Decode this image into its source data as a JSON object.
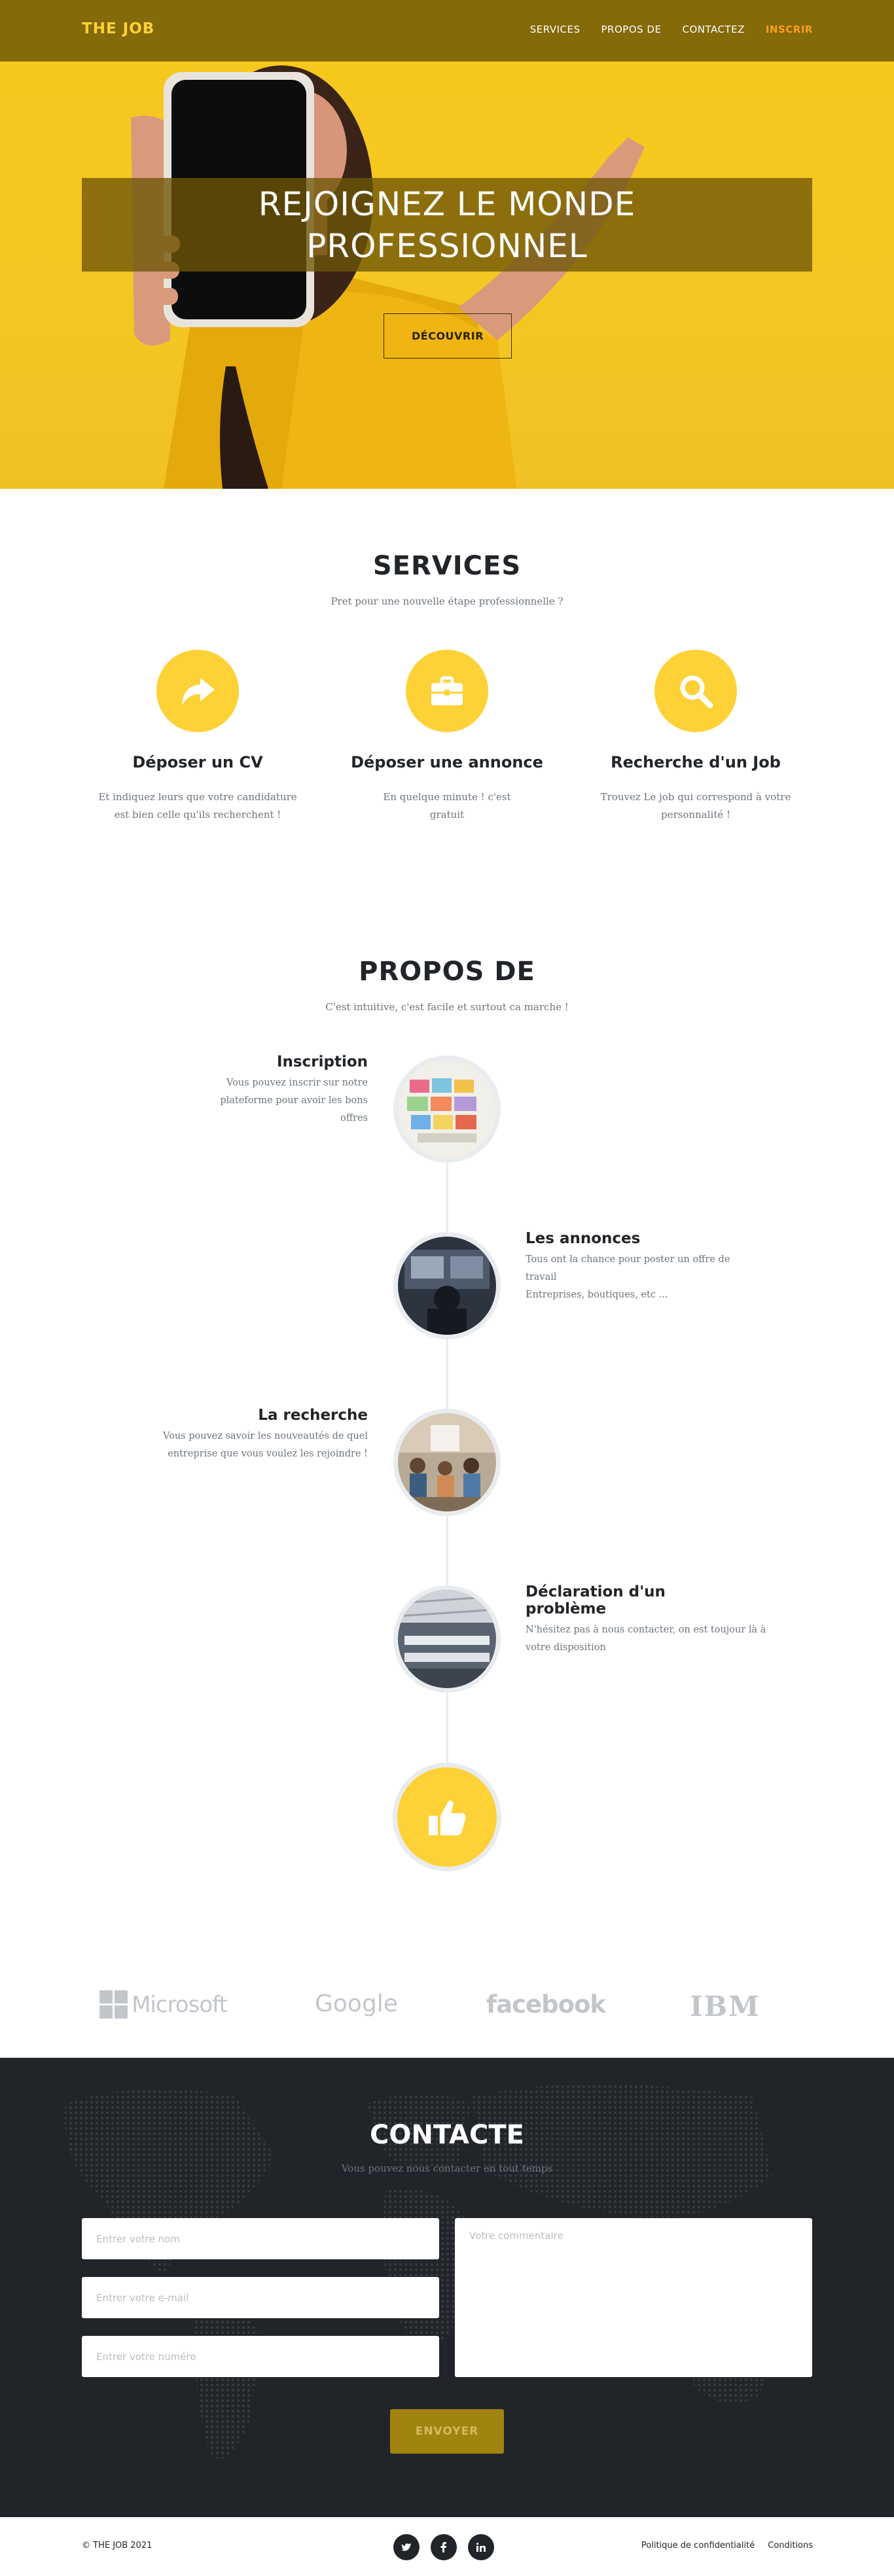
{
  "nav": {
    "brand": "THE JOB",
    "links": [
      "SERVICES",
      "PROPOS DE",
      "CONTACTEZ",
      "INSCRIR"
    ]
  },
  "hero": {
    "title": "REJOIGNEZ LE MONDE PROFESSIONNEL",
    "button": "DÉCOUVRIR"
  },
  "services": {
    "title": "SERVICES",
    "subtitle": "Pret pour une nouvelle étape professionnelle ?",
    "items": [
      {
        "icon": "share-arrow-icon",
        "title": "Déposer un CV",
        "text": "Et indiquez leurs que votre candidature est bien celle qu'ils recherchent !"
      },
      {
        "icon": "briefcase-icon",
        "title": "Déposer une annonce",
        "text": "En quelque minute ! c'est gratuit"
      },
      {
        "icon": "search-icon",
        "title": "Recherche d'un Job",
        "text": "Trouvez Le job qui correspond à votre personnalité !"
      }
    ]
  },
  "about": {
    "title": "PROPOS DE",
    "subtitle": "C'est intuitive, c'est facile et surtout ca marche !",
    "items": [
      {
        "title": "Inscription",
        "text": "Vous pouvez inscrir sur notre plateforme pour avoir les bons offres"
      },
      {
        "title": "Les annonces",
        "text": "Tous ont la chance pour poster un offre de travail",
        "text2": "Entreprises, boutiques, etc ..."
      },
      {
        "title": "La recherche",
        "text": "Vous pouvez savoir les nouveautés de quel entreprise que vous voulez les rejoindre !"
      },
      {
        "title": "Déclaration d'un problème",
        "text": "N'hésitez pas à nous contacter, on est toujour là à votre disposition"
      }
    ],
    "final_icon": "thumbs-up-icon"
  },
  "logos": [
    "Microsoft",
    "Google",
    "facebook",
    "IBM"
  ],
  "contact": {
    "title": "CONTACTE",
    "subtitle": "Vous pouvez nous contacter en tout temps",
    "name_placeholder": "Entrer votre nom",
    "email_placeholder": "Entrer votre e-mail",
    "phone_placeholder": "Entrer votre numéro",
    "comment_placeholder": "Votre commentaire",
    "send": "ENVOYER"
  },
  "footer": {
    "copyright": "© THE JOB 2021",
    "socials": [
      "twitter-icon",
      "facebook-icon",
      "linkedin-icon"
    ],
    "links": [
      "Politique de confidentialité",
      "Conditions"
    ]
  },
  "colors": {
    "accent": "#fed136",
    "nav": "#826809",
    "dark": "#212529",
    "muted": "#6c757d"
  }
}
